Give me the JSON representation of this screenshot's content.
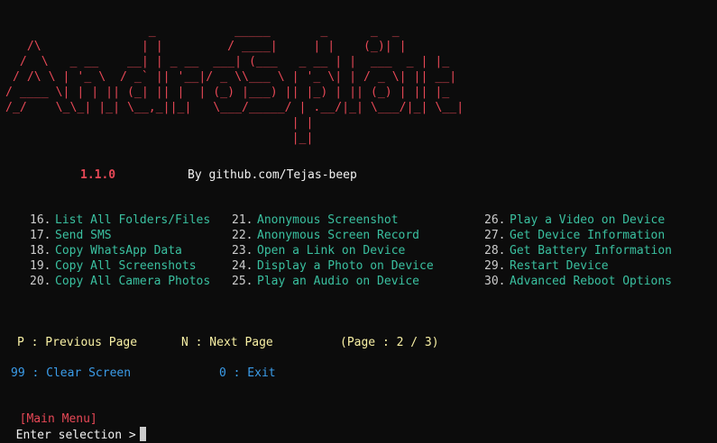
{
  "banner": {
    "ascii_art": "                    _           _____       _      _  _\n   /\\              | |         / ____|     | |    (_)| |\n  /  \\   _ __    __| | _ __  ___| (___   _ __ | |  ___  _ | |_\n / /\\ \\ | '_ \\  / _` || '__|/ _ \\\\___ \\ | '_ \\| | / _ \\| || __|\n/ ____ \\| | | || (_| || |  | (_) |___) || |_) | || (_) | || |_\n/_/    \\_\\_| |_| \\__,_||_|   \\___/_____/ | .__/|_| \\___/|_| \\__|\n                                        | |\n                                        |_|",
    "version": "1.1.0",
    "author": "By github.com/Tejas-beep"
  },
  "menu": {
    "col1": [
      {
        "num": "16.",
        "label": "List All Folders/Files"
      },
      {
        "num": "17.",
        "label": "Send SMS"
      },
      {
        "num": "18.",
        "label": "Copy WhatsApp Data"
      },
      {
        "num": "19.",
        "label": "Copy All Screenshots"
      },
      {
        "num": "20.",
        "label": "Copy All Camera Photos"
      }
    ],
    "col2": [
      {
        "num": "21.",
        "label": "Anonymous Screenshot"
      },
      {
        "num": "22.",
        "label": "Anonymous Screen Record"
      },
      {
        "num": "23.",
        "label": "Open a Link on Device"
      },
      {
        "num": "24.",
        "label": "Display a Photo on Device"
      },
      {
        "num": "25.",
        "label": "Play an Audio on Device"
      }
    ],
    "col3": [
      {
        "num": "26.",
        "label": "Play a Video on Device"
      },
      {
        "num": "27.",
        "label": "Get Device Information"
      },
      {
        "num": "28.",
        "label": "Get Battery Information"
      },
      {
        "num": "29.",
        "label": "Restart Device"
      },
      {
        "num": "30.",
        "label": "Advanced Reboot Options"
      }
    ]
  },
  "nav": {
    "previous": "P : Previous Page",
    "next": "N : Next Page",
    "page": "(Page : 2 / 3)",
    "clear": "99 : Clear Screen",
    "exit": "0 : Exit"
  },
  "prompt": {
    "tag": "[Main Menu]",
    "text": "Enter selection >"
  },
  "colors": {
    "background": "#0c0c0c",
    "banner": "#e74856",
    "option": "#16c60c",
    "nav": "#f9f1a5",
    "secondary": "#3b9dea"
  }
}
